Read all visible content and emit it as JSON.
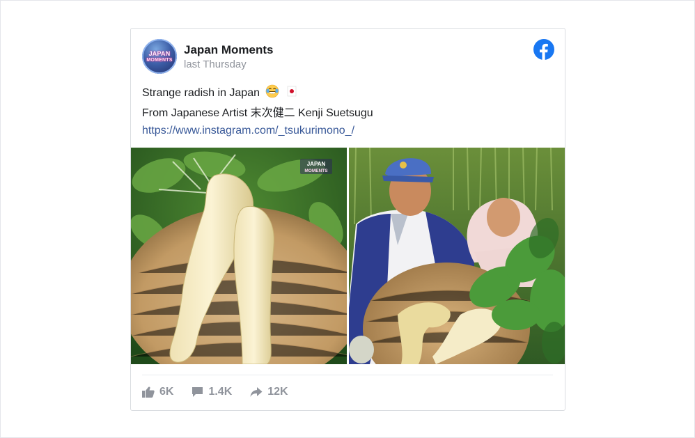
{
  "post": {
    "page_name": "Japan Moments",
    "timestamp": "last Thursday",
    "text_line1": "Strange radish in Japan",
    "text_line2": "From Japanese Artist 末次健二 Kenji Suetsugu",
    "link": "https://www.instagram.com/_tsukurimono_/",
    "avatar_text": [
      "JAPAN",
      "MOMENTS"
    ],
    "watermark": [
      "JAPAN",
      "MOMENTS"
    ],
    "emoji": [
      "laughing-crying-emoji",
      "japan-flag-emoji"
    ]
  },
  "stats": {
    "likes": "6K",
    "comments": "1.4K",
    "shares": "12K"
  },
  "icons": {
    "facebook": "facebook-icon",
    "like": "thumbs-up-icon",
    "comment": "speech-bubble-icon",
    "share": "share-arrow-icon"
  },
  "colors": {
    "facebook_blue": "#1877f2",
    "link": "#385898",
    "muted": "#90949c"
  }
}
